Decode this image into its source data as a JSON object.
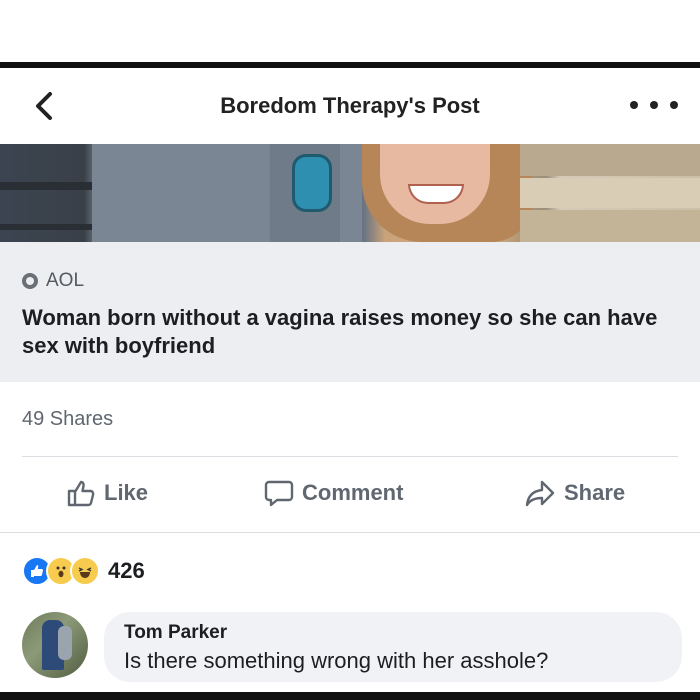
{
  "header": {
    "title": "Boredom Therapy's Post",
    "back_icon": "chevron-left-icon",
    "more_icon": "more-dots-icon"
  },
  "link_preview": {
    "source": "AOL",
    "headline": "Woman born without a vagina raises money so she can have sex with boyfriend"
  },
  "post_stats": {
    "shares": "49 Shares"
  },
  "actions": {
    "like_label": "Like",
    "comment_label": "Comment",
    "share_label": "Share"
  },
  "reactions": {
    "count": "426",
    "types": [
      "like",
      "wow",
      "haha"
    ]
  },
  "comment": {
    "author": "Tom Parker",
    "text": "Is there something wrong with her asshole?"
  },
  "colors": {
    "like_blue": "#1877f2",
    "emoji_yellow": "#f7cb4d",
    "text_gray": "#606770"
  }
}
